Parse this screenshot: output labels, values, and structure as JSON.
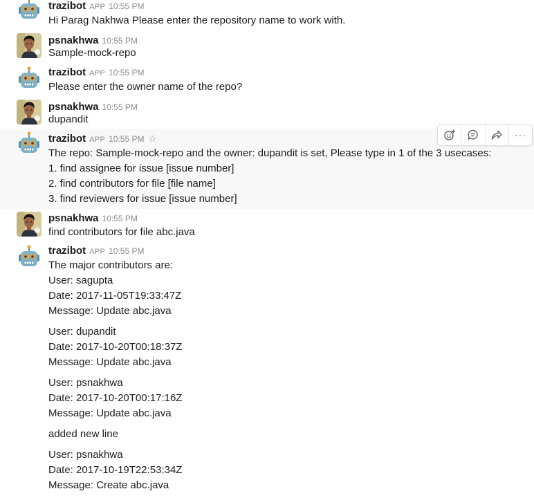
{
  "bot_name": "trazibot",
  "user_name": "psnakhwa",
  "app_badge": "APP",
  "messages": [
    {
      "sender": "trazibot",
      "time": "10:55 PM",
      "lines": [
        "Hi Parag Nakhwa Please enter the repository name to work with."
      ]
    },
    {
      "sender": "psnakhwa",
      "time": "10:55 PM",
      "lines": [
        "Sample-mock-repo"
      ]
    },
    {
      "sender": "trazibot",
      "time": "10:55 PM",
      "lines": [
        "Please enter the owner name of the repo?"
      ]
    },
    {
      "sender": "psnakhwa",
      "time": "10:55 PM",
      "lines": [
        "dupandit"
      ]
    },
    {
      "sender": "trazibot",
      "time": "10:55 PM",
      "lines": [
        "The repo: Sample-mock-repo and the owner: dupandit is set,  Please type in 1 of the 3 usecases:",
        "1. find assignee for issue [issue number]",
        "2. find contributors for file [file name]",
        "3. find reviewers for issue [issue number]"
      ]
    },
    {
      "sender": "psnakhwa",
      "time": "10:55 PM",
      "lines": [
        "find contributors for file abc.java"
      ]
    },
    {
      "sender": "trazibot",
      "time": "10:55 PM",
      "lines": [
        "The major contributors are:",
        "User: sagupta",
        "Date: 2017-11-05T19:33:47Z",
        "Message: Update abc.java",
        "User: dupandit",
        "Date: 2017-10-20T00:18:37Z",
        "Message: Update abc.java",
        "User: psnakhwa",
        "Date: 2017-10-20T00:17:16Z",
        "Message: Update abc.java",
        "added new line",
        "User: psnakhwa",
        "Date: 2017-10-19T22:53:34Z",
        "Message: Create abc.java"
      ]
    }
  ],
  "hover_toolbar": {
    "actions": [
      "add-reaction",
      "start-thread",
      "share-message",
      "more-actions"
    ],
    "more_label": "···"
  },
  "colors": {
    "text": "#1d1c1d",
    "muted": "#8b8b8b",
    "hover_bg": "#f8f8f8",
    "bot_head": "#7fb3c8",
    "bot_eyes": "#e9a23b"
  }
}
